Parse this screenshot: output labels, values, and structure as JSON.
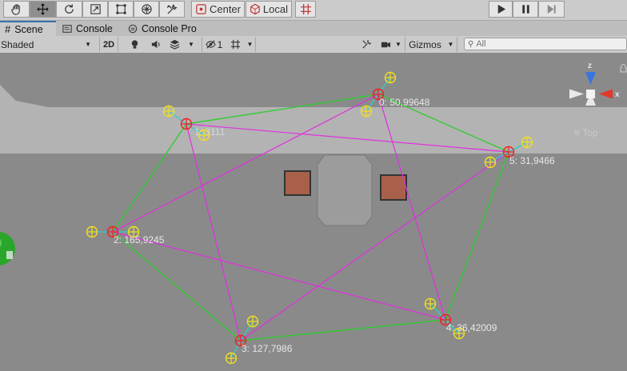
{
  "toolbar": {
    "tools": [
      {
        "name": "hand-tool-icon"
      },
      {
        "name": "move-tool-icon",
        "active": true
      },
      {
        "name": "rotate-tool-icon"
      },
      {
        "name": "scale-tool-icon"
      },
      {
        "name": "rect-tool-icon"
      },
      {
        "name": "transform-tool-icon"
      },
      {
        "name": "custom-tool-icon"
      }
    ],
    "pivot_label": "Center",
    "space_label": "Local",
    "snap_icon": "grid-snap-icon",
    "play_icon": "play-icon",
    "pause_icon": "pause-icon",
    "step_icon": "step-icon"
  },
  "tabs": [
    {
      "label": "Scene",
      "active": true,
      "icon": "scene-icon"
    },
    {
      "label": "Console",
      "active": false,
      "icon": "console-icon"
    },
    {
      "label": "Console Pro",
      "active": false,
      "icon": "console-pro-icon"
    }
  ],
  "scene_toolbar": {
    "draw_mode": "Shaded",
    "mode_2d": "2D",
    "hidden_count": "1",
    "gizmos_label": "Gizmos",
    "search_placeholder": "All"
  },
  "scene": {
    "view_label": "Top",
    "axis_z": "z",
    "axis_x": "x",
    "nodes": [
      {
        "label": "0: 50,99648"
      },
      {
        "label": "1: 3111"
      },
      {
        "label": "2: 165,9245"
      },
      {
        "label": "3: 127,7986"
      },
      {
        "label": "4: 36,42009"
      },
      {
        "label": "5: 31,9466"
      }
    ]
  },
  "colors": {
    "toolbar_bg": "#cbcbcb",
    "scene_bg": "#8a8a8a",
    "road": "#b3b3b3",
    "green_edge": "#33cc33",
    "magenta_edge": "#e030e0",
    "handle_red": "#ee2222",
    "handle_yellow": "#f0e020",
    "cyan": "#33cccc",
    "crate": "#a8604a"
  }
}
